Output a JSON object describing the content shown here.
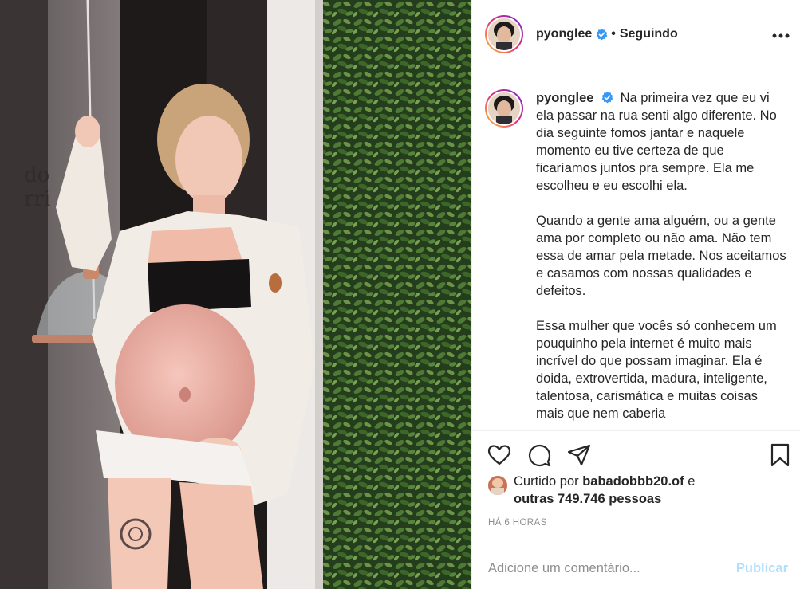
{
  "post": {
    "username": "pyonglee",
    "follow_separator": "•",
    "follow_status": "Seguindo",
    "more_icon": "more-options-icon",
    "verified_icon": "verified-badge-icon"
  },
  "caption": {
    "username": "pyonglee",
    "paragraphs": [
      "Na primeira vez que eu vi ela passar na rua senti algo diferente. No dia seguinte fomos jantar e naquele momento eu tive certeza de que ficaríamos juntos pra sempre. Ela me escolheu e eu escolhi ela.",
      "Quando a gente ama alguém, ou a gente ama por completo ou não ama. Não tem essa de amar pela metade. Nos aceitamos e casamos com nossas qualidades e defeitos.",
      "Essa mulher que vocês só conhecem um pouquinho pela internet é muito mais incrível do que possam imaginar. Ela é doida, extrovertida, madura, inteligente, talentosa, carismática e muitas coisas mais que nem caberia"
    ]
  },
  "actions": {
    "like_icon": "heart-icon",
    "comment_icon": "comment-icon",
    "share_icon": "paper-plane-icon",
    "save_icon": "bookmark-icon"
  },
  "likes": {
    "prefix": "Curtido por ",
    "liker": "babadobbb20.of",
    "conjunction": " e",
    "others": "outras 749.746 pessoas"
  },
  "timestamp": "HÁ 6 HORAS",
  "comment": {
    "placeholder": "Adicione um comentário...",
    "publish_label": "Publicar"
  },
  "colors": {
    "verified": "#3897f0",
    "publish_disabled": "#b2dffc",
    "muted_text": "#8e8e8e"
  }
}
